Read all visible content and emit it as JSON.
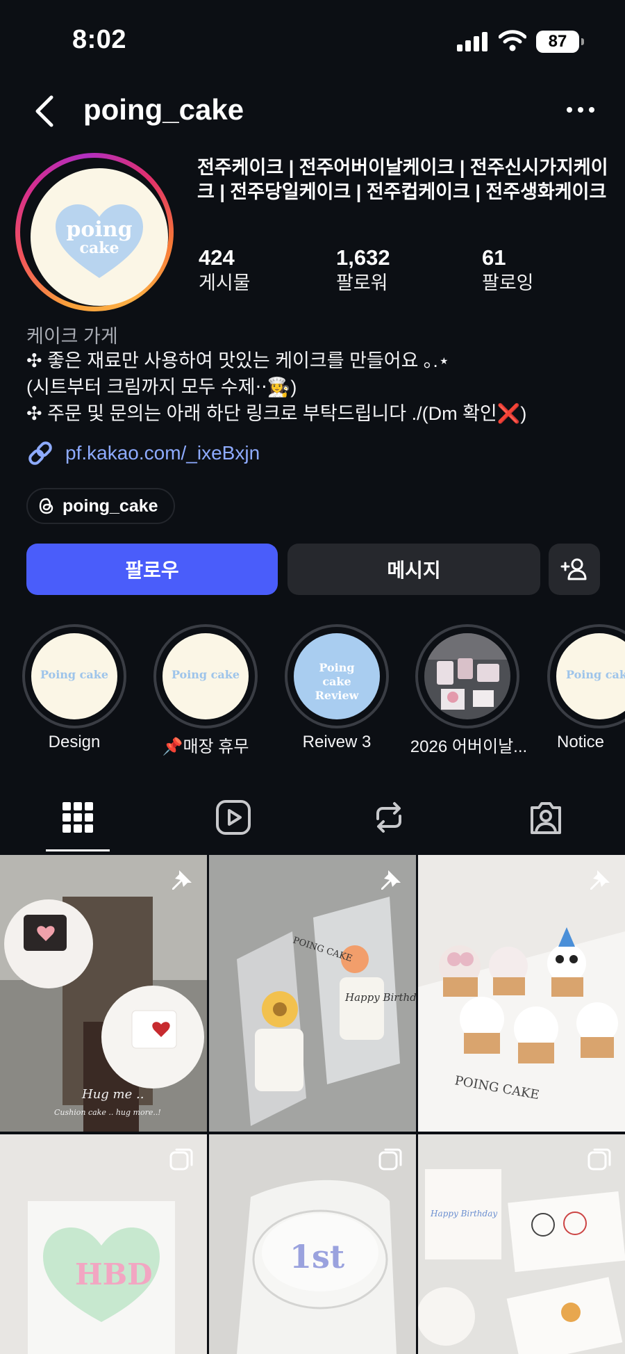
{
  "status_bar": {
    "time": "8:02",
    "battery": "87"
  },
  "header": {
    "username": "poing_cake"
  },
  "profile": {
    "avatar_text_1": "poing",
    "avatar_text_2": "cake",
    "category_title": "전주케이크 | 전주어버이날케이크 | 전주신시가지케이크 | 전주당일케이크 | 전주컵케이크 | 전주생화케이크",
    "stats": [
      {
        "value": "424",
        "label": "게시물"
      },
      {
        "value": "1,632",
        "label": "팔로워"
      },
      {
        "value": "61",
        "label": "팔로잉"
      }
    ],
    "category": "케이크 가게",
    "bio_lines": [
      "✣ 좋은 재료만 사용하여 맛있는 케이크를 만들어요 ｡.⋆",
      "(시트부터 크림까지 모두 수제‧‧👩‍🍳)",
      "✣ 주문 및 문의는 아래 하단 링크로 부탁드립니다 ./(Dm 확인❌)"
    ],
    "link": "pf.kakao.com/_ixeBxjn",
    "threads_handle": "poing_cake"
  },
  "actions": {
    "follow": "팔로우",
    "message": "메시지"
  },
  "highlights": [
    {
      "label": "Design",
      "cover_text": "Poing cake"
    },
    {
      "label": "📌매장 휴무",
      "cover_text": "Poing cake"
    },
    {
      "label": "Reivew 3",
      "cover_text": "Poing cake Review"
    },
    {
      "label": "2026 어버이날...",
      "cover_text": ""
    },
    {
      "label": "Notice",
      "cover_text": "Poing cak"
    }
  ],
  "grid": {
    "captions": [
      "Hug me ..",
      "Cushion cake .. hug more..!",
      "POING CAKE",
      "Happy Birthday",
      "POING CAKE",
      "HBD",
      "1st",
      "Happy Birthday"
    ]
  },
  "colors": {
    "accent": "#4a5dfa",
    "link": "#8eabff",
    "background": "#0c0f14"
  }
}
